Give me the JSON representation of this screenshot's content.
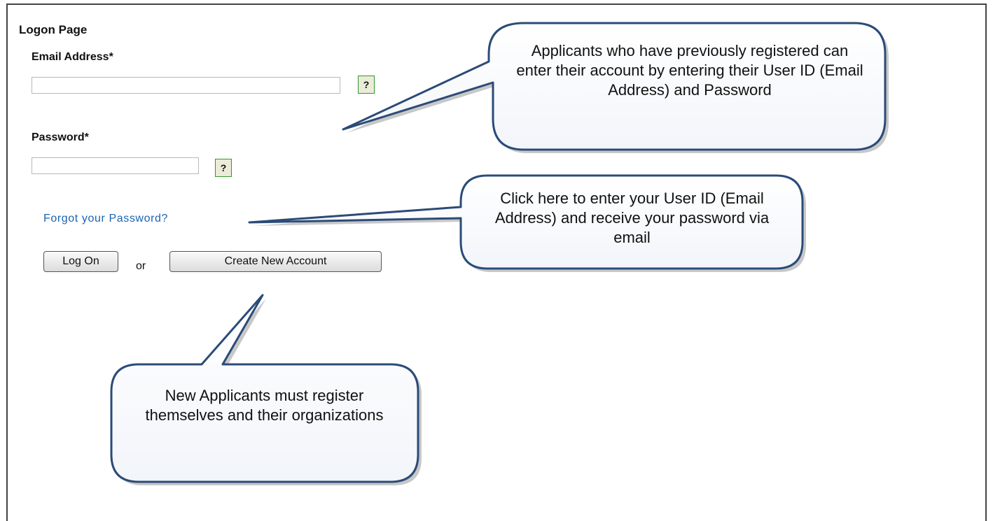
{
  "page_title": "Logon Page",
  "form": {
    "email_label": "Email Address*",
    "email_value": "",
    "password_label": "Password*",
    "password_value": "",
    "help_label": "?",
    "forgot_link": "Forgot your Password?",
    "logon_button": "Log On",
    "or_text": "or",
    "create_button": "Create New Account"
  },
  "callouts": {
    "previous_applicants": "Applicants who have previously registered can enter their account by entering their User ID (Email Address) and Password",
    "forgot_password": "Click here to enter your User ID (Email Address) and receive your password via email",
    "new_applicants": "New Applicants must register themselves and their organizations"
  },
  "colors": {
    "callout_border": "#2b4b78",
    "link": "#1a63b4",
    "help_border": "#2f9a31"
  }
}
